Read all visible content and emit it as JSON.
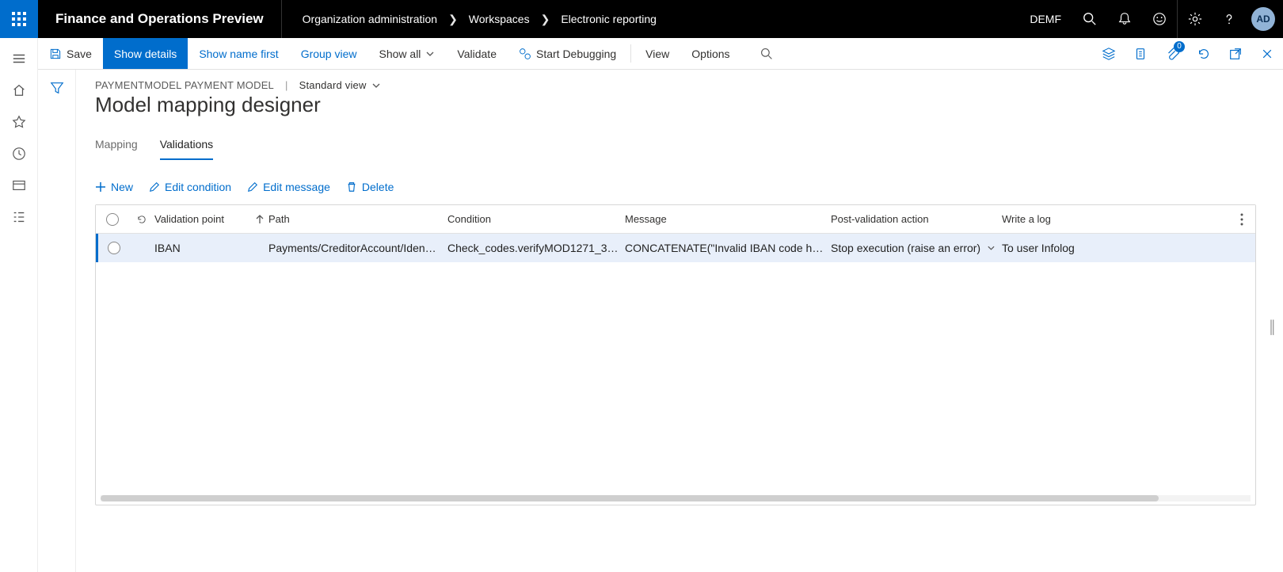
{
  "topbar": {
    "app_name": "Finance and Operations Preview",
    "company": "DEMF",
    "avatar": "AD",
    "breadcrumb": [
      "Organization administration",
      "Workspaces",
      "Electronic reporting"
    ]
  },
  "actionbar": {
    "save": "Save",
    "show_details": "Show details",
    "show_name_first": "Show name first",
    "group_view": "Group view",
    "show_all": "Show all",
    "validate": "Validate",
    "start_debugging": "Start Debugging",
    "view": "View",
    "options": "Options",
    "attach_badge": "0"
  },
  "header": {
    "breadcrumb": "PAYMENTMODEL PAYMENT MODEL",
    "view_label": "Standard view",
    "title": "Model mapping designer"
  },
  "tabs": {
    "mapping": "Mapping",
    "validations": "Validations"
  },
  "toolbar": {
    "new": "New",
    "edit_condition": "Edit condition",
    "edit_message": "Edit message",
    "delete": "Delete"
  },
  "grid": {
    "columns": {
      "validation_point": "Validation point",
      "path": "Path",
      "condition": "Condition",
      "message": "Message",
      "post_action": "Post-validation action",
      "write_log": "Write a log"
    },
    "rows": [
      {
        "validation_point": "IBAN",
        "path": "Payments/CreditorAccount/Iden…",
        "condition": "Check_codes.verifyMOD1271_3…",
        "message": "CONCATENATE(\"Invalid IBAN code ha…",
        "post_action": "Stop execution (raise an error)",
        "write_log": "To user Infolog"
      }
    ]
  }
}
